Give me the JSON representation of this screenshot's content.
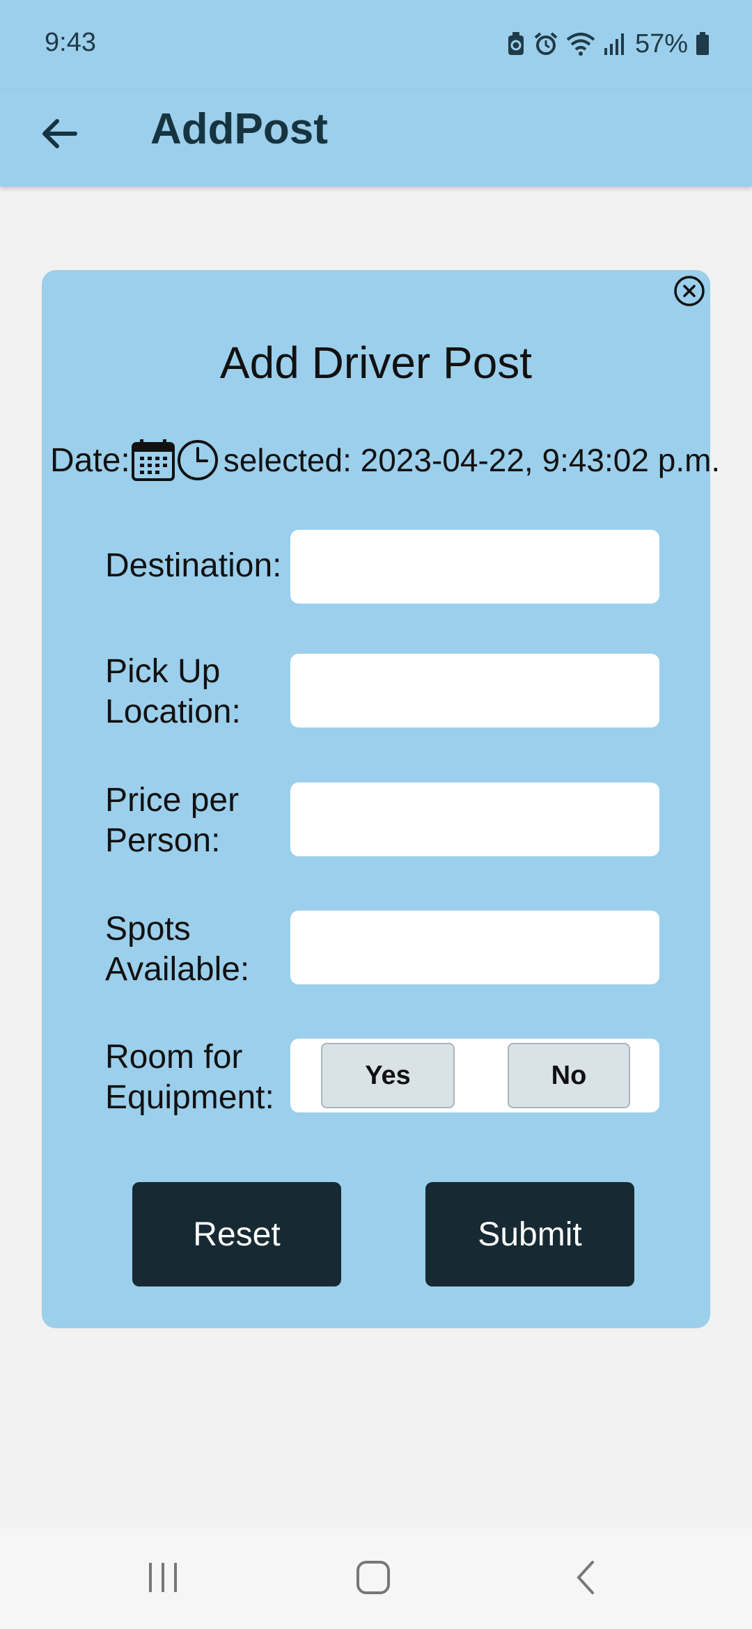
{
  "status_bar": {
    "time": "9:43",
    "battery": "57%",
    "icons": [
      "battery-saver-icon",
      "alarm-icon",
      "wifi-icon",
      "signal-icon",
      "battery-icon"
    ]
  },
  "app_bar": {
    "title": "AddPost",
    "back_icon": "arrow-back-icon"
  },
  "dialog": {
    "title": "Add Driver Post",
    "close_icon": "close-circle-icon",
    "date": {
      "label": "Date:",
      "calendar_icon": "calendar-icon",
      "clock_icon": "clock-icon",
      "selected_text": "selected: 2023-04-22, 9:43:02 p.m."
    },
    "fields": {
      "destination": {
        "label": "Destination:",
        "value": ""
      },
      "pickup": {
        "label": "Pick Up Location:",
        "value": ""
      },
      "price": {
        "label": "Price per Person:",
        "value": ""
      },
      "spots": {
        "label": "Spots Available:",
        "value": ""
      }
    },
    "equipment": {
      "label": "Room for Equipment:",
      "yes": "Yes",
      "no": "No"
    },
    "buttons": {
      "reset": "Reset",
      "submit": "Submit"
    }
  },
  "nav_bar": {
    "icons": [
      "recent-apps-icon",
      "home-icon",
      "back-icon"
    ]
  },
  "colors": {
    "header": "#9ccfeb",
    "dialog": "#9ccfeb",
    "button_dark": "#172a33",
    "background": "#f2f2f2"
  }
}
